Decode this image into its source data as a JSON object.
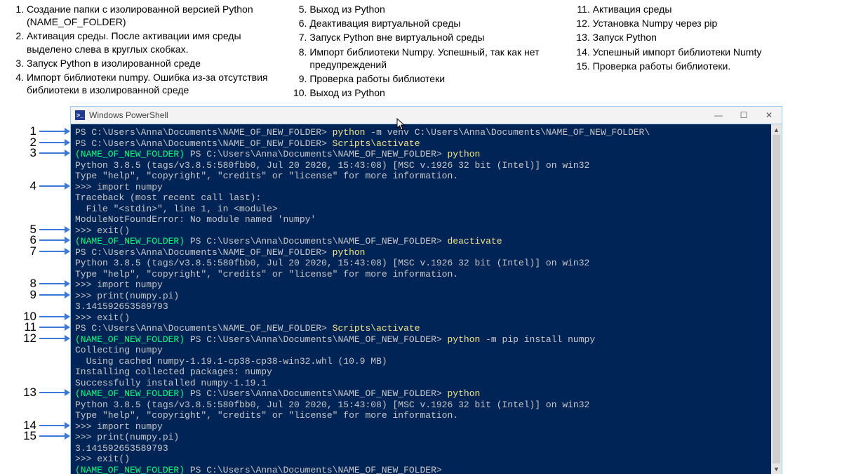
{
  "steps": {
    "col1": [
      "Создание папки с изолированной версией Python (NAME_OF_FOLDER)",
      "Активация среды. После активации имя среды выделено слева в круглых скобках.",
      "Запуск Python в изолированной среде",
      "Импорт библиотеки numpy. Ошибка из-за отсутствия библиотеки в изолированной среде"
    ],
    "col1_start": 1,
    "col2": [
      "Выход из Python",
      "Деактивация виртуальной среды",
      "Запуск Python вне виртуальной среды",
      "Импорт библиотеки Numpy. Успешный, так как нет предупреждений",
      "Проверка работы библиотеки",
      "Выход из Python"
    ],
    "col2_start": 5,
    "col3": [
      "Активация среды",
      "Установка Numpy через pip",
      "Запуск Python",
      "Успешный импорт библиотеки Numty",
      "Проверка работы библиотеки."
    ],
    "col3_start": 11
  },
  "window": {
    "title": "Windows PowerShell",
    "icon_text": ">_"
  },
  "arrows": [
    {
      "n": 1,
      "line": 0
    },
    {
      "n": 2,
      "line": 1
    },
    {
      "n": 3,
      "line": 2
    },
    {
      "n": 4,
      "line": 5
    },
    {
      "n": 5,
      "line": 9
    },
    {
      "n": 6,
      "line": 10
    },
    {
      "n": 7,
      "line": 11
    },
    {
      "n": 8,
      "line": 14
    },
    {
      "n": 9,
      "line": 15
    },
    {
      "n": 10,
      "line": 17
    },
    {
      "n": 11,
      "line": 18
    },
    {
      "n": 12,
      "line": 19
    },
    {
      "n": 13,
      "line": 24
    },
    {
      "n": 14,
      "line": 27
    },
    {
      "n": 15,
      "line": 28
    }
  ],
  "terminal_lines": [
    [
      {
        "c": "c-grey",
        "t": "PS C:\\Users\\Anna\\Documents\\NAME_OF_NEW_FOLDER> "
      },
      {
        "c": "c-yellow",
        "t": "python"
      },
      {
        "c": "c-grey",
        "t": " -m venv C:\\Users\\Anna\\Documents\\NAME_OF_NEW_FOLDER\\"
      }
    ],
    [
      {
        "c": "c-grey",
        "t": "PS C:\\Users\\Anna\\Documents\\NAME_OF_NEW_FOLDER> "
      },
      {
        "c": "c-yellow",
        "t": "Scripts\\activate"
      }
    ],
    [
      {
        "c": "c-green",
        "t": "(NAME_OF_NEW_FOLDER)"
      },
      {
        "c": "c-grey",
        "t": " PS C:\\Users\\Anna\\Documents\\NAME_OF_NEW_FOLDER> "
      },
      {
        "c": "c-yellow",
        "t": "python"
      }
    ],
    [
      {
        "c": "c-grey",
        "t": "Python 3.8.5 (tags/v3.8.5:580fbb0, Jul 20 2020, 15:43:08) [MSC v.1926 32 bit (Intel)] on win32"
      }
    ],
    [
      {
        "c": "c-grey",
        "t": "Type \"help\", \"copyright\", \"credits\" or \"license\" for more information."
      }
    ],
    [
      {
        "c": "c-grey",
        "t": ">>> import numpy"
      }
    ],
    [
      {
        "c": "c-grey",
        "t": "Traceback (most recent call last):"
      }
    ],
    [
      {
        "c": "c-grey",
        "t": "  File \"<stdin>\", line 1, in <module>"
      }
    ],
    [
      {
        "c": "c-grey",
        "t": "ModuleNotFoundError: No module named 'numpy'"
      }
    ],
    [
      {
        "c": "c-grey",
        "t": ">>> exit()"
      }
    ],
    [
      {
        "c": "c-green",
        "t": "(NAME_OF_NEW_FOLDER)"
      },
      {
        "c": "c-grey",
        "t": " PS C:\\Users\\Anna\\Documents\\NAME_OF_NEW_FOLDER> "
      },
      {
        "c": "c-yellow",
        "t": "deactivate"
      }
    ],
    [
      {
        "c": "c-grey",
        "t": "PS C:\\Users\\Anna\\Documents\\NAME_OF_NEW_FOLDER> "
      },
      {
        "c": "c-yellow",
        "t": "python"
      }
    ],
    [
      {
        "c": "c-grey",
        "t": "Python 3.8.5 (tags/v3.8.5:580fbb0, Jul 20 2020, 15:43:08) [MSC v.1926 32 bit (Intel)] on win32"
      }
    ],
    [
      {
        "c": "c-grey",
        "t": "Type \"help\", \"copyright\", \"credits\" or \"license\" for more information."
      }
    ],
    [
      {
        "c": "c-grey",
        "t": ">>> import numpy"
      }
    ],
    [
      {
        "c": "c-grey",
        "t": ">>> print(numpy.pi)"
      }
    ],
    [
      {
        "c": "c-grey",
        "t": "3.141592653589793"
      }
    ],
    [
      {
        "c": "c-grey",
        "t": ">>> exit()"
      }
    ],
    [
      {
        "c": "c-grey",
        "t": "PS C:\\Users\\Anna\\Documents\\NAME_OF_NEW_FOLDER> "
      },
      {
        "c": "c-yellow",
        "t": "Scripts\\activate"
      }
    ],
    [
      {
        "c": "c-green",
        "t": "(NAME_OF_NEW_FOLDER)"
      },
      {
        "c": "c-grey",
        "t": " PS C:\\Users\\Anna\\Documents\\NAME_OF_NEW_FOLDER> "
      },
      {
        "c": "c-yellow",
        "t": "python"
      },
      {
        "c": "c-grey",
        "t": " -m pip install numpy"
      }
    ],
    [
      {
        "c": "c-grey",
        "t": "Collecting numpy"
      }
    ],
    [
      {
        "c": "c-grey",
        "t": "  Using cached numpy-1.19.1-cp38-cp38-win32.whl (10.9 MB)"
      }
    ],
    [
      {
        "c": "c-grey",
        "t": "Installing collected packages: numpy"
      }
    ],
    [
      {
        "c": "c-grey",
        "t": "Successfully installed numpy-1.19.1"
      }
    ],
    [
      {
        "c": "c-green",
        "t": "(NAME_OF_NEW_FOLDER)"
      },
      {
        "c": "c-grey",
        "t": " PS C:\\Users\\Anna\\Documents\\NAME_OF_NEW_FOLDER> "
      },
      {
        "c": "c-yellow",
        "t": "python"
      }
    ],
    [
      {
        "c": "c-grey",
        "t": "Python 3.8.5 (tags/v3.8.5:580fbb0, Jul 20 2020, 15:43:08) [MSC v.1926 32 bit (Intel)] on win32"
      }
    ],
    [
      {
        "c": "c-grey",
        "t": "Type \"help\", \"copyright\", \"credits\" or \"license\" for more information."
      }
    ],
    [
      {
        "c": "c-grey",
        "t": ">>> import numpy"
      }
    ],
    [
      {
        "c": "c-grey",
        "t": ">>> print(numpy.pi)"
      }
    ],
    [
      {
        "c": "c-grey",
        "t": "3.141592653589793"
      }
    ],
    [
      {
        "c": "c-grey",
        "t": ">>> exit()"
      }
    ],
    [
      {
        "c": "c-green",
        "t": "(NAME_OF_NEW_FOLDER)"
      },
      {
        "c": "c-grey",
        "t": " PS C:\\Users\\Anna\\Documents\\NAME_OF_NEW_FOLDER>"
      }
    ]
  ],
  "colors": {
    "arrow": "#3b78d8",
    "term_bg": "#012456"
  }
}
